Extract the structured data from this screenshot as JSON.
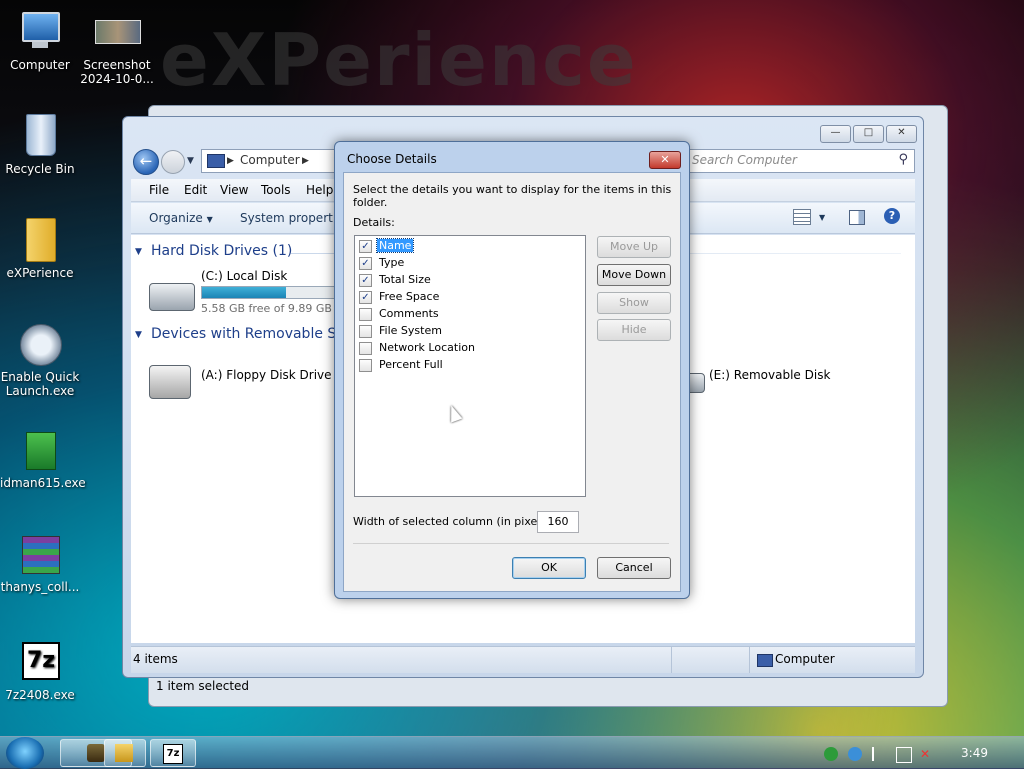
{
  "desktop": {
    "watermark": "eXPerience",
    "icons": [
      {
        "label": "Computer"
      },
      {
        "label": "Screenshot 2024-10-0..."
      },
      {
        "label": "Recycle Bin"
      },
      {
        "label": "eXPerience"
      },
      {
        "label": "Enable Quick Launch.exe"
      },
      {
        "label": "idman615.exe"
      },
      {
        "label": "thanys_coll..."
      },
      {
        "label": "7z2408.exe"
      }
    ]
  },
  "back_window": {
    "status": "1 item selected"
  },
  "explorer": {
    "address": "Computer",
    "search_placeholder": "Search Computer",
    "menu": [
      "File",
      "Edit",
      "View",
      "Tools",
      "Help"
    ],
    "commands": {
      "organize": "Organize",
      "system_properties": "System properties"
    },
    "groups": [
      {
        "title": "Hard Disk Drives (1)"
      },
      {
        "title": "Devices with Removable Sto"
      }
    ],
    "drives": {
      "local": {
        "name": "(C:) Local Disk",
        "free": "5.58 GB free of 9.89 GB",
        "used_fraction": 0.44
      },
      "floppy": {
        "name": "(A:) Floppy Disk Drive"
      },
      "removable": {
        "name": "(E:) Removable Disk"
      }
    },
    "status": {
      "items": "4 items",
      "location": "Computer"
    }
  },
  "dialog": {
    "title": "Choose Details",
    "description": "Select the details you want to display for the items in this folder.",
    "details_label": "Details:",
    "details": [
      {
        "label": "Name",
        "checked": true,
        "selected": true
      },
      {
        "label": "Type",
        "checked": true,
        "selected": false
      },
      {
        "label": "Total Size",
        "checked": true,
        "selected": false
      },
      {
        "label": "Free Space",
        "checked": true,
        "selected": false
      },
      {
        "label": "Comments",
        "checked": false,
        "selected": false
      },
      {
        "label": "File System",
        "checked": false,
        "selected": false
      },
      {
        "label": "Network Location",
        "checked": false,
        "selected": false
      },
      {
        "label": "Percent Full",
        "checked": false,
        "selected": false
      }
    ],
    "buttons": {
      "move_up": "Move Up",
      "move_down": "Move Down",
      "show": "Show",
      "hide": "Hide",
      "ok": "OK",
      "cancel": "Cancel"
    },
    "width_label": "Width of selected column (in pixels):",
    "width_value": "160"
  },
  "taskbar": {
    "clock": "3:49"
  }
}
